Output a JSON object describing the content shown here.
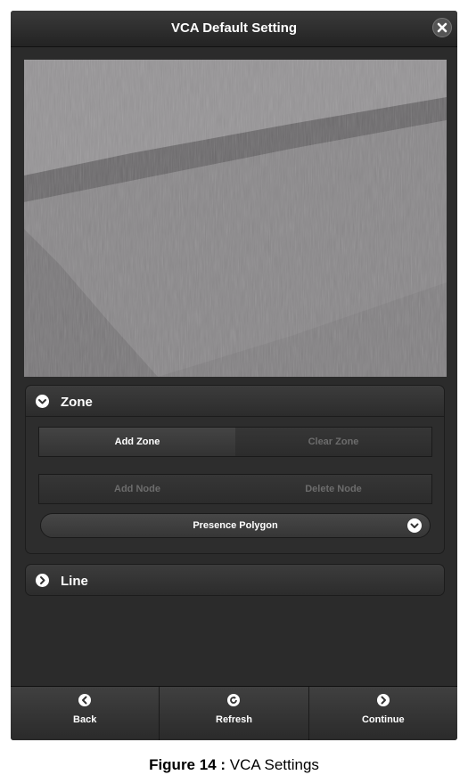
{
  "window": {
    "title": "VCA Default Setting",
    "close_icon": "close-icon"
  },
  "zone": {
    "label": "Zone",
    "add_zone": "Add Zone",
    "clear_zone": "Clear Zone",
    "add_node": "Add Node",
    "delete_node": "Delete Node",
    "dropdown_value": "Presence Polygon"
  },
  "line": {
    "label": "Line"
  },
  "footer": {
    "back": "Back",
    "refresh": "Refresh",
    "continue": "Continue"
  },
  "caption": {
    "prefix": "Figure 14 :",
    "text": "VCA Settings"
  }
}
